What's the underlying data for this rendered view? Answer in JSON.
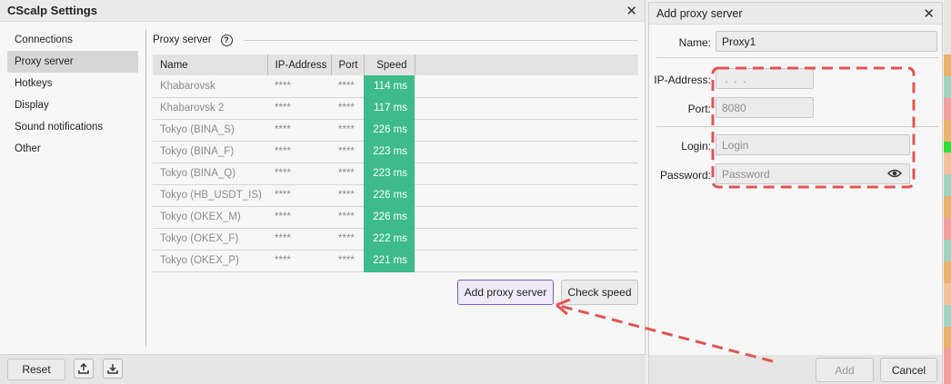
{
  "window": {
    "title": "CScalp Settings"
  },
  "nav": [
    {
      "label": "Connections",
      "active": false
    },
    {
      "label": "Proxy server",
      "active": true
    },
    {
      "label": "Hotkeys",
      "active": false
    },
    {
      "label": "Display",
      "active": false
    },
    {
      "label": "Sound notifications",
      "active": false
    },
    {
      "label": "Other",
      "active": false
    }
  ],
  "section": {
    "title": "Proxy server",
    "help_icon": "question-circle-icon"
  },
  "table": {
    "columns": [
      "Name",
      "IP-Address",
      "Port",
      "Speed"
    ],
    "rows": [
      {
        "name": "Khabarovsk",
        "ip": "****",
        "port": "****",
        "speed": "114 ms"
      },
      {
        "name": "Khabarovsk 2",
        "ip": "****",
        "port": "****",
        "speed": "117 ms"
      },
      {
        "name": "Tokyo (BINA_S)",
        "ip": "****",
        "port": "****",
        "speed": "226 ms"
      },
      {
        "name": "Tokyo (BINA_F)",
        "ip": "****",
        "port": "****",
        "speed": "223 ms"
      },
      {
        "name": "Tokyo (BINA_Q)",
        "ip": "****",
        "port": "****",
        "speed": "223 ms"
      },
      {
        "name": "Tokyo (HB_USDT_IS)",
        "ip": "****",
        "port": "****",
        "speed": "226 ms"
      },
      {
        "name": "Tokyo (OKEX_M)",
        "ip": "****",
        "port": "****",
        "speed": "226 ms"
      },
      {
        "name": "Tokyo (OKEX_F)",
        "ip": "****",
        "port": "****",
        "speed": "222 ms"
      },
      {
        "name": "Tokyo (OKEX_P)",
        "ip": "****",
        "port": "****",
        "speed": "221 ms"
      }
    ]
  },
  "buttons": {
    "add_proxy": "Add proxy server",
    "check_speed": "Check speed",
    "reset": "Reset",
    "upload_icon": "upload-icon",
    "download_icon": "download-icon"
  },
  "dialog": {
    "title": "Add proxy server",
    "name_label": "Name:",
    "name_value": "Proxy1",
    "ip_label": "IP-Address:",
    "ip_value": " .  .  .",
    "port_label": "Port:",
    "port_value": "8080",
    "login_label": "Login:",
    "login_placeholder": "Login",
    "password_label": "Password:",
    "password_placeholder": "Password",
    "add": "Add",
    "cancel": "Cancel"
  },
  "colors": {
    "speed_green": "#3dbb8a",
    "accent_purple": "#7b5ccc",
    "annotation_red": "#e05555"
  }
}
